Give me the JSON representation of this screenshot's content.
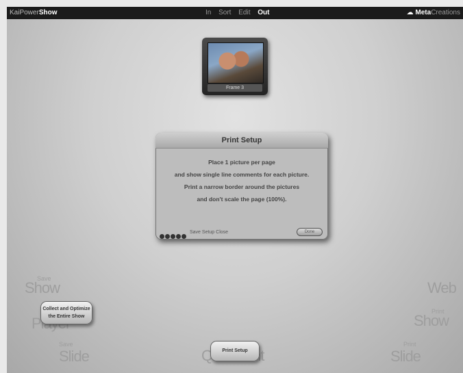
{
  "topbar": {
    "brand_prefix": "KaiPower",
    "brand_name": "Show",
    "modes": [
      "In",
      "Sort",
      "Edit",
      "Out"
    ],
    "active_mode": "Out",
    "meta_bold": "Meta",
    "meta_rest": "Creations"
  },
  "thumbnail": {
    "caption": "Frame 3"
  },
  "dialog": {
    "title": "Print Setup",
    "lines": [
      "Place 1 picture per page",
      "and show single line comments for each picture.",
      "Print a narrow border around the pictures",
      "and don't scale the page (100%)."
    ],
    "footer_label": "Save Setup Close",
    "button_label": "Done"
  },
  "output_options": {
    "save_show_small": "Save",
    "save_show_big": "Show",
    "player_big": "Player",
    "collect_button": "Collect and Optimize the Entire Show",
    "save_slide_small": "Save",
    "save_slide_big": "Slide",
    "quickprint_big": "QuickPrint",
    "print_setup_button": "Print Setup",
    "web_big": "Web",
    "print_show_small": "Print",
    "print_show_big": "Show",
    "print_slide_small": "Print",
    "print_slide_big": "Slide"
  }
}
